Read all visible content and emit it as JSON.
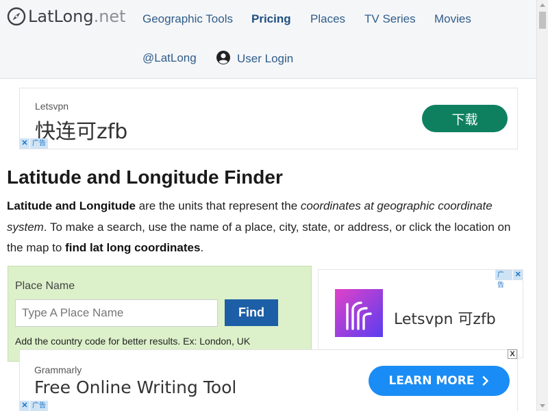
{
  "site": {
    "logo_main": "LatLong",
    "logo_tld": ".net"
  },
  "nav": {
    "items": [
      {
        "label": "Geographic Tools"
      },
      {
        "label": "Pricing"
      },
      {
        "label": "Places"
      },
      {
        "label": "TV Series"
      },
      {
        "label": "Movies"
      },
      {
        "label": "@LatLong"
      },
      {
        "label": "User Login"
      }
    ]
  },
  "ad_top": {
    "brand": "Letsvpn",
    "headline": "快连可zfb",
    "cta": "下载",
    "cta_color": "#0e8060",
    "adchoice_x": "✕",
    "adchoice_label": "广告"
  },
  "main": {
    "title": "Latitude and Longitude Finder",
    "intro_bold_1": "Latitude and Longitude",
    "intro_text_1": " are the units that represent the ",
    "intro_italic_1": "coordinates at geographic coordinate system",
    "intro_text_2": ". To make a search, use the name of a place, city, state, or address, or click the location on the map to ",
    "intro_bold_2": "find lat long coordinates",
    "intro_text_3": "."
  },
  "search": {
    "label": "Place Name",
    "placeholder": "Type A Place Name",
    "value": "",
    "button": "Find",
    "hint": "Add the country code for better results. Ex: London, UK",
    "panel_color": "#dcf0ca",
    "button_color": "#1d5fa6"
  },
  "ad_right": {
    "title": "Letsvpn 可zfb",
    "adchoice_label": "广告",
    "adchoice_x": "✕"
  },
  "ad_bottom": {
    "brand": "Grammarly",
    "headline": "Free Online Writing Tool",
    "cta": "LEARN MORE",
    "cta_icon": "chevron-right-icon",
    "cta_color": "#1a8cf5",
    "adchoice_x": "✕",
    "adchoice_label": "广告",
    "close": "X"
  }
}
